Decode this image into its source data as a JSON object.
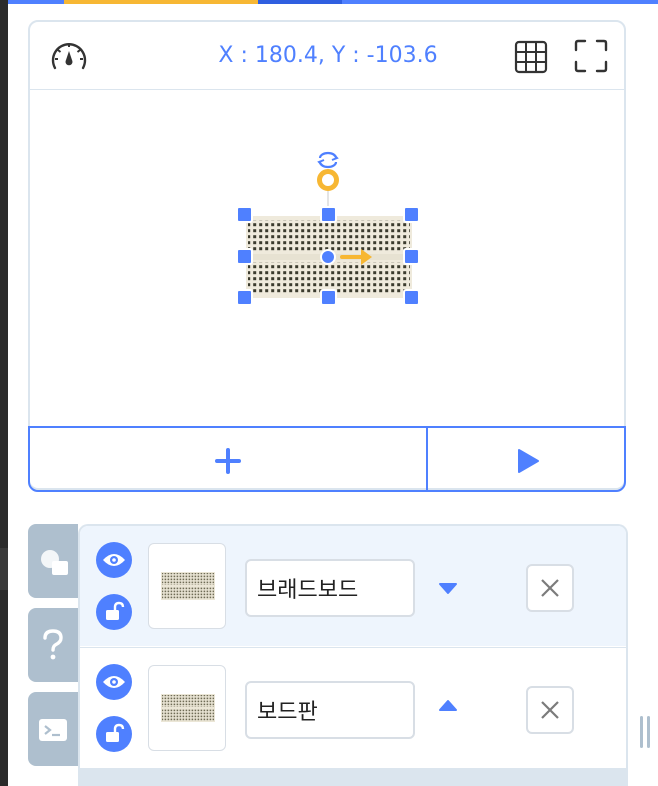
{
  "stage": {
    "coordinates": "X : 180.4, Y : -103.6",
    "object_x": 180.4,
    "object_y": -103.6
  },
  "objects": [
    {
      "name": "브래드보드",
      "selected": true,
      "visible": true,
      "locked": false,
      "order_arrow": "down"
    },
    {
      "name": "보드판",
      "selected": false,
      "visible": true,
      "locked": false,
      "order_arrow": "up"
    }
  ],
  "icons": {
    "speed": "speedometer-icon",
    "grid": "grid-icon",
    "fullscreen": "fullscreen-icon",
    "add": "plus-icon",
    "play": "play-icon",
    "eye": "eye-icon",
    "lock": "unlock-icon",
    "delete": "close-icon",
    "tab_object": "shape-icon",
    "tab_help": "question-icon",
    "tab_console": "terminal-icon"
  },
  "colors": {
    "accent": "#4f80ff",
    "handle_yellow": "#f7b733",
    "tab_gray": "#aebfce",
    "border": "#dbe5ee",
    "selected_row": "#eef5fd"
  }
}
